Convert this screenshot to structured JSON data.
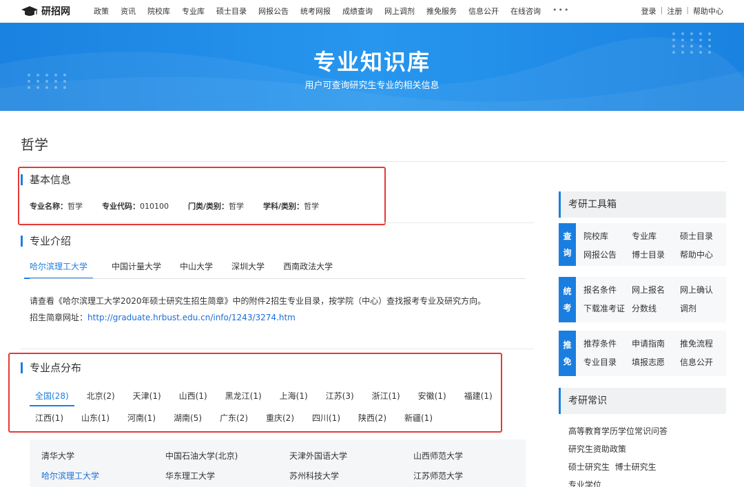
{
  "brand": {
    "name": "研招网"
  },
  "nav": {
    "items": [
      "政策",
      "资讯",
      "院校库",
      "专业库",
      "硕士目录",
      "网报公告",
      "统考网报",
      "成绩查询",
      "网上调剂",
      "推免服务",
      "信息公开",
      "在线咨询"
    ],
    "more": "•••",
    "login": "登录",
    "register": "注册",
    "help": "帮助中心",
    "sep": "|"
  },
  "banner": {
    "title": "专业知识库",
    "subtitle": "用户可查询研究生专业的相关信息"
  },
  "page": {
    "title": "哲学"
  },
  "basic_info": {
    "heading": "基本信息",
    "fields": [
      {
        "label": "专业名称：",
        "value": "哲学"
      },
      {
        "label": "专业代码：",
        "value": "010100"
      },
      {
        "label": "门类/类别：",
        "value": "哲学"
      },
      {
        "label": "学科/类别：",
        "value": "哲学"
      }
    ]
  },
  "intro": {
    "heading": "专业介绍",
    "tabs": [
      "哈尔滨理工大学",
      "中国计量大学",
      "中山大学",
      "深圳大学",
      "西南政法大学"
    ],
    "text": "请查看《哈尔滨理工大学2020年硕士研究生招生简章》中的附件2招生专业目录，按学院（中心）查找报考专业及研究方向。",
    "url_label": "招生简章网址：",
    "url": "http://graduate.hrbust.edu.cn/info/1243/3274.htm"
  },
  "distribution": {
    "heading": "专业点分布",
    "row1": [
      "全国(28)",
      "北京(2)",
      "天津(1)",
      "山西(1)",
      "黑龙江(1)",
      "上海(1)",
      "江苏(3)",
      "浙江(1)",
      "安徽(1)",
      "福建(1)"
    ],
    "row2": [
      "江西(1)",
      "山东(1)",
      "河南(1)",
      "湖南(5)",
      "广东(2)",
      "重庆(2)",
      "四川(1)",
      "陕西(2)",
      "新疆(1)"
    ],
    "schools": [
      "清华大学",
      "中国石油大学(北京)",
      "天津外国语大学",
      "山西师范大学",
      "哈尔滨理工大学",
      "华东理工大学",
      "苏州科技大学",
      "江苏师范大学"
    ]
  },
  "toolbox": {
    "heading": "考研工具箱",
    "groups": [
      {
        "label": [
          "查",
          "询"
        ],
        "links": [
          "院校库",
          "专业库",
          "硕士目录",
          "网报公告",
          "博士目录",
          "帮助中心"
        ]
      },
      {
        "label": [
          "统",
          "考"
        ],
        "links": [
          "报名条件",
          "网上报名",
          "网上确认",
          "下载准考证",
          "分数线",
          "调剂"
        ]
      },
      {
        "label": [
          "推",
          "免"
        ],
        "links": [
          "推荐条件",
          "申请指南",
          "推免流程",
          "专业目录",
          "填报志愿",
          "信息公开"
        ]
      }
    ]
  },
  "knowledge": {
    "heading": "考研常识",
    "items": [
      "高等教育学历学位常识问答",
      "研究生资助政策",
      "硕士研究生",
      "博士研究生",
      "专业学位"
    ]
  },
  "colors": {
    "accent": "#1a7ee0",
    "highlight_box": "#e53935",
    "banner": "#2190ea"
  }
}
